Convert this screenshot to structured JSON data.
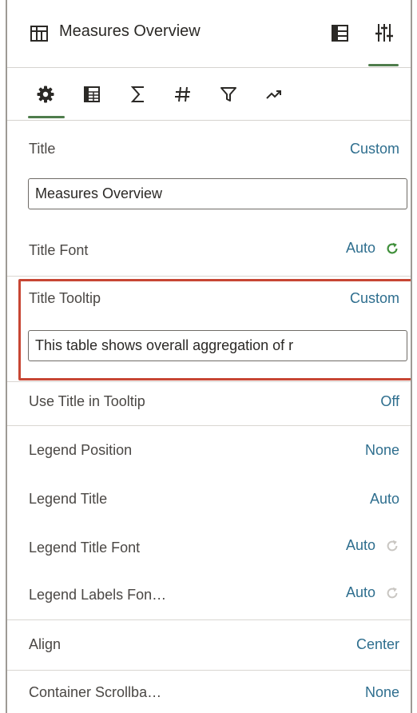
{
  "header": {
    "title": "Measures Overview",
    "icons": [
      "table-icon",
      "layout-panel-icon",
      "properties-sliders-icon"
    ]
  },
  "tabs": [
    {
      "icon": "gear-icon",
      "active": true
    },
    {
      "icon": "table-grid-icon",
      "active": false
    },
    {
      "icon": "sigma-icon",
      "active": false
    },
    {
      "icon": "hash-icon",
      "active": false
    },
    {
      "icon": "filter-icon",
      "active": false
    },
    {
      "icon": "trend-icon",
      "active": false
    }
  ],
  "properties": {
    "title": {
      "label": "Title",
      "value": "Custom",
      "input_value": "Measures Overview"
    },
    "title_font": {
      "label": "Title Font",
      "value": "Auto"
    },
    "title_tooltip": {
      "label": "Title Tooltip",
      "value": "Custom",
      "input_value": "This table shows overall aggregation of r"
    },
    "use_title_in_tooltip": {
      "label": "Use Title in Tooltip",
      "value": "Off"
    },
    "legend_position": {
      "label": "Legend Position",
      "value": "None"
    },
    "legend_title": {
      "label": "Legend Title",
      "value": "Auto"
    },
    "legend_title_font": {
      "label": "Legend Title Font",
      "value": "Auto"
    },
    "legend_labels_font": {
      "label": "Legend Labels Fon…",
      "value": "Auto"
    },
    "align": {
      "label": "Align",
      "value": "Center"
    },
    "container_scrollbar": {
      "label": "Container Scrollba…",
      "value": "None"
    }
  },
  "colors": {
    "value_link": "#2e6e8e",
    "active_tab": "#4f7d4c",
    "refresh_active": "#3f8f3a",
    "refresh_inactive": "#c9c6c2",
    "highlight_border": "#c74634"
  }
}
